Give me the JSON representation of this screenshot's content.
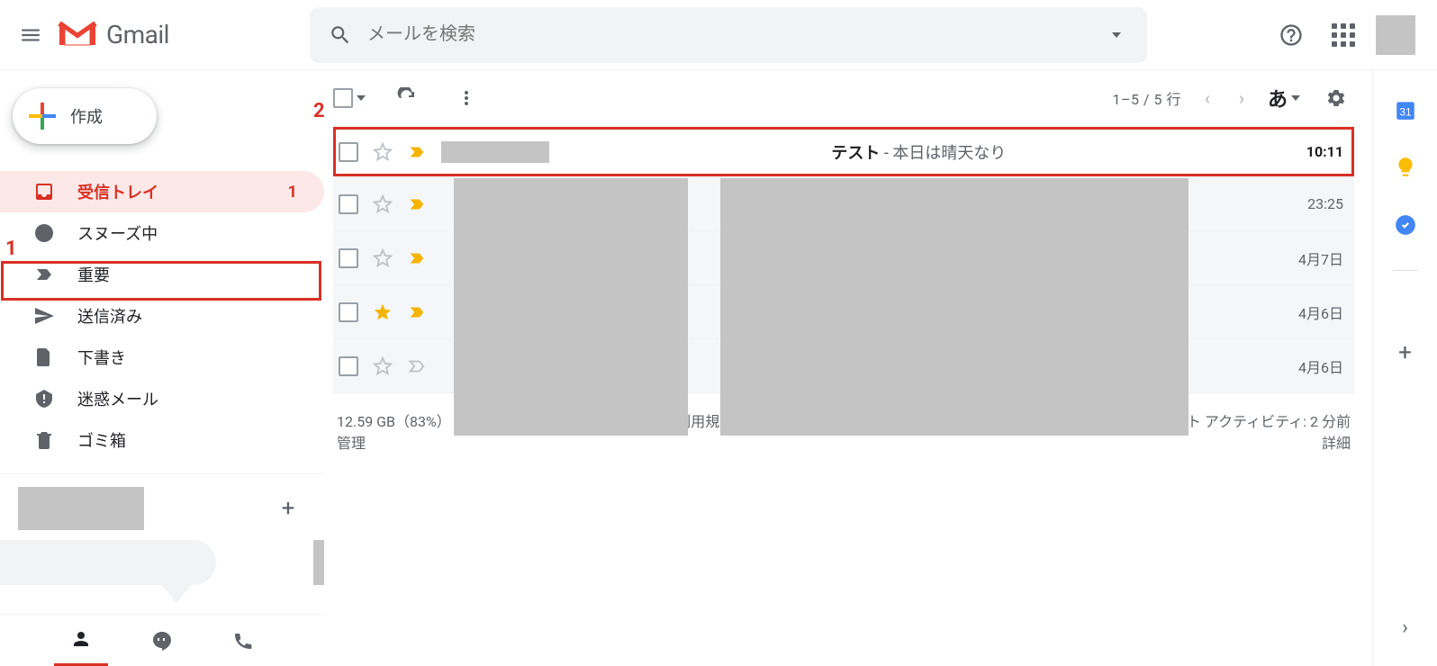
{
  "header": {
    "brand": "Gmail",
    "search_placeholder": "メールを検索"
  },
  "compose_label": "作成",
  "sidebar": {
    "items": [
      {
        "label": "受信トレイ",
        "count": "1",
        "icon": "inbox"
      },
      {
        "label": "スヌーズ中",
        "icon": "clock"
      },
      {
        "label": "重要",
        "icon": "important"
      },
      {
        "label": "送信済み",
        "icon": "sent"
      },
      {
        "label": "下書き",
        "icon": "draft"
      },
      {
        "label": "迷惑メール",
        "icon": "spam"
      },
      {
        "label": "ゴミ箱",
        "icon": "trash"
      }
    ]
  },
  "toolbar": {
    "page_count": "1–5 / 5 行",
    "lang_indicator": "あ"
  },
  "emails": [
    {
      "subject": "テスト",
      "snippet": " - 本日は晴天なり",
      "time": "10:11",
      "unread": true,
      "important": true,
      "starred": false,
      "highlighted": true
    },
    {
      "time": "23:25",
      "important": true,
      "starred": false
    },
    {
      "time": "4月7日",
      "important": true,
      "starred": false
    },
    {
      "time": "4月6日",
      "important": true,
      "starred": true
    },
    {
      "time": "4月6日",
      "important": false,
      "starred": false
    }
  ],
  "footer": {
    "storage_line1": "12.59 GB（83%） / 15 GB を使用中",
    "storage_line2": "管理",
    "links": "利用規約 · プライバシー · プログラム ポリシー",
    "activity_line1": "前回のアカウント アクティビティ: 2 分前",
    "activity_line2": "詳細"
  },
  "annotations": {
    "a1": "1",
    "a2": "2"
  }
}
